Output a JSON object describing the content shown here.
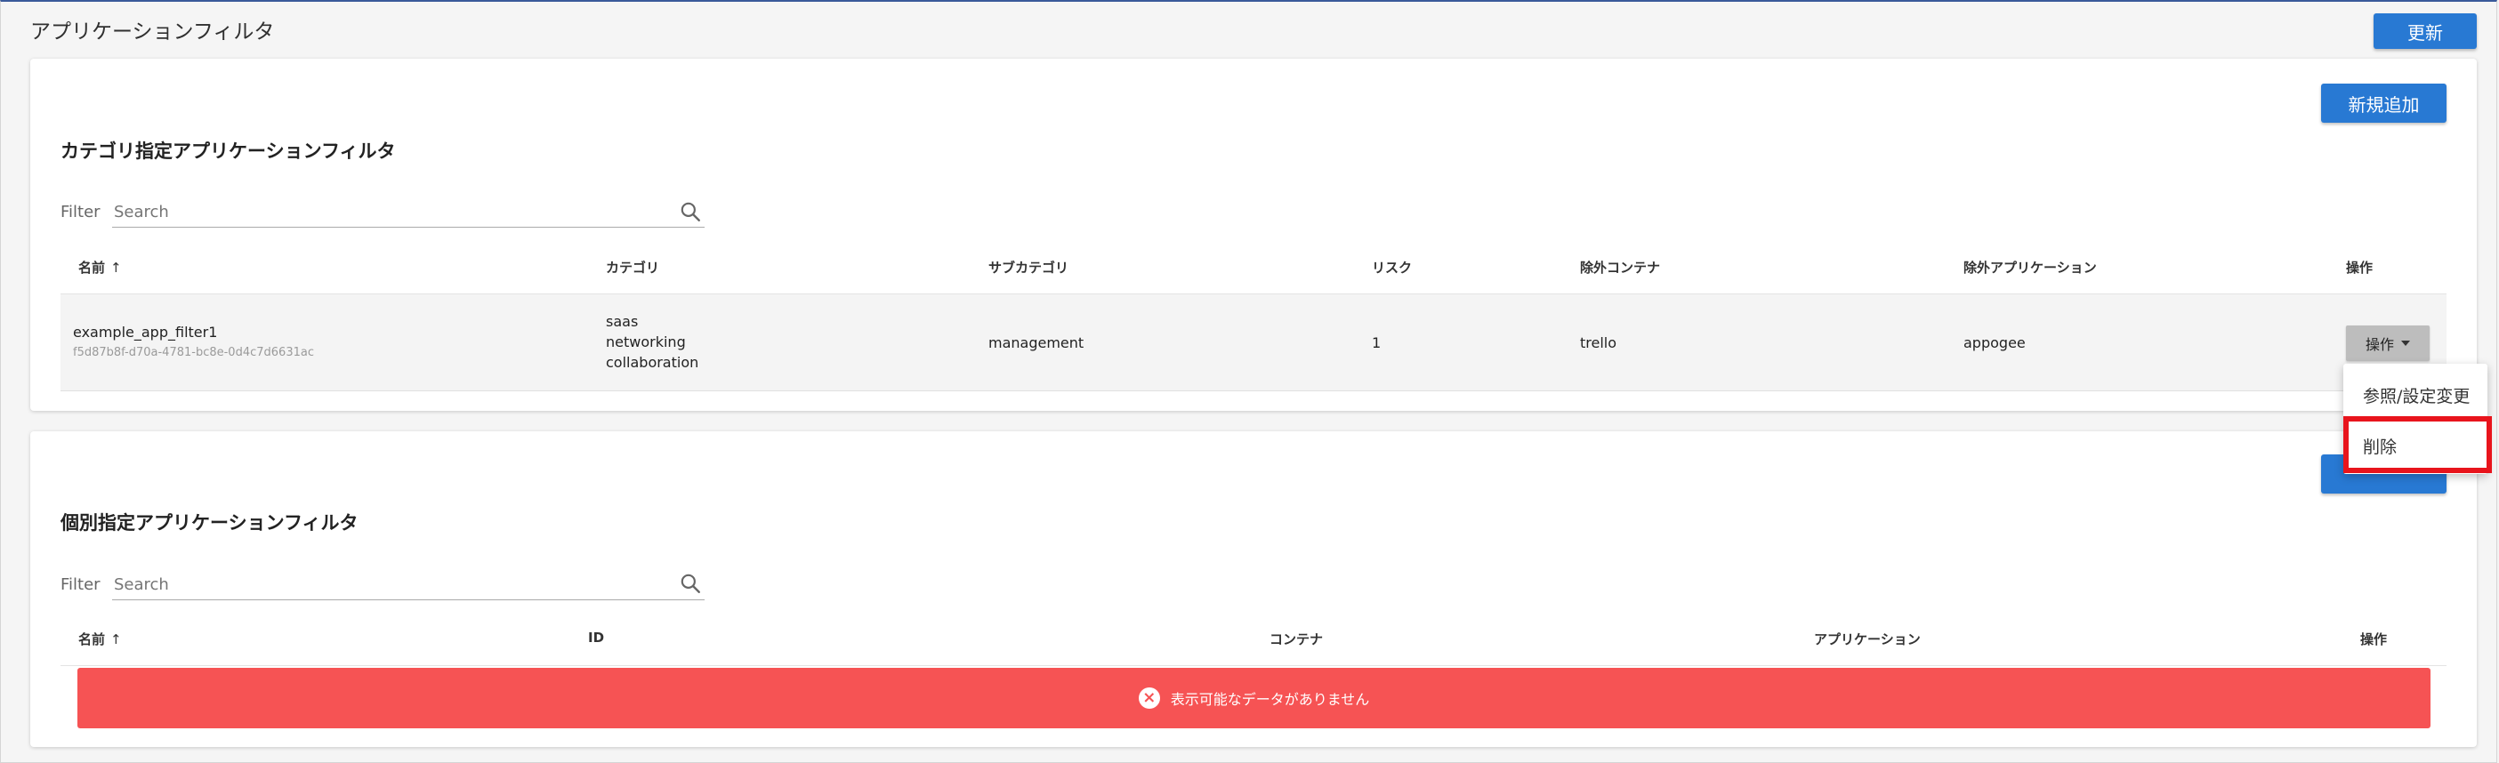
{
  "page": {
    "title": "アプリケーションフィルタ",
    "refresh_label": "更新"
  },
  "category_filters": {
    "title": "カテゴリ指定アプリケーションフィルタ",
    "add_label": "新規追加",
    "filter_label": "Filter",
    "search_placeholder": "Search",
    "columns": [
      "名前",
      "カテゴリ",
      "サブカテゴリ",
      "リスク",
      "除外コンテナ",
      "除外アプリケーション",
      "操作"
    ],
    "sort_indicator": "↑",
    "rows": [
      {
        "name": "example_app_filter1",
        "id": "f5d87b8f-d70a-4781-bc8e-0d4c7d6631ac",
        "categories": [
          "saas",
          "networking",
          "collaboration"
        ],
        "subcategory": "management",
        "risk": "1",
        "excluded_container": "trello",
        "excluded_application": "appogee",
        "action_label": "操作"
      }
    ],
    "action_menu": {
      "items": [
        "参照/設定変更",
        "削除"
      ],
      "highlighted": "削除"
    }
  },
  "individual_filters": {
    "title": "個別指定アプリケーションフィルタ",
    "filter_label": "Filter",
    "search_placeholder": "Search",
    "columns": [
      "名前",
      "ID",
      "コンテナ",
      "アプリケーション",
      "操作"
    ],
    "sort_indicator": "↑",
    "empty_message": "表示可能なデータがありません"
  },
  "colors": {
    "primary": "#2879d3",
    "error": "#f65354",
    "highlight": "#e8141c"
  }
}
